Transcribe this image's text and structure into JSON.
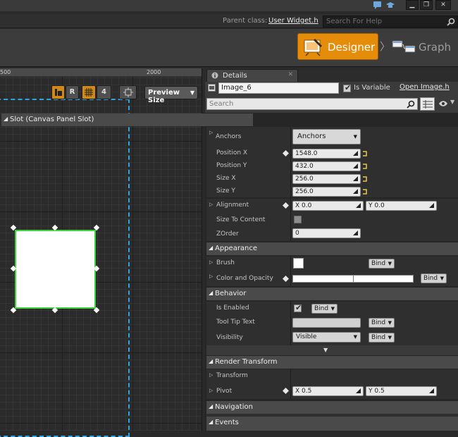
{
  "titlebar": {
    "minimize": "▁",
    "maximize": "❐",
    "close": "✕"
  },
  "parent": {
    "label": "Parent class:",
    "value": "User Widget.h",
    "help_placeholder": "Search For Help"
  },
  "modes": {
    "designer": "Designer",
    "graph": "Graph",
    "separator": "〉"
  },
  "canvas": {
    "ruler": [
      "500",
      "2000"
    ],
    "toolbar": {
      "r_label": "R",
      "grid_size": "4",
      "preview_size": "Preview Size"
    }
  },
  "details": {
    "tab_label": "Details",
    "tab_close": "✕",
    "widget_name": "Image_6",
    "is_variable_label": "Is Variable",
    "is_variable": true,
    "open_link": "Open Image.h",
    "search_placeholder": "Search",
    "sections": {
      "slot": "Slot (Canvas Panel Slot)",
      "appearance": "Appearance",
      "behavior": "Behavior",
      "render_transform": "Render Transform",
      "navigation": "Navigation",
      "events": "Events"
    },
    "slot": {
      "anchors_label": "Anchors",
      "anchors_value": "Anchors",
      "position_x_label": "Position X",
      "position_x": "1548.0",
      "position_y_label": "Position Y",
      "position_y": "432.0",
      "size_x_label": "Size X",
      "size_x": "256.0",
      "size_y_label": "Size Y",
      "size_y": "256.0",
      "alignment_label": "Alignment",
      "alignment_x": "X  0.0",
      "alignment_y": "Y  0.0",
      "size_to_content_label": "Size To Content",
      "zorder_label": "ZOrder",
      "zorder": "0"
    },
    "appearance": {
      "brush_label": "Brush",
      "color_label": "Color and Opacity",
      "bind": "Bind"
    },
    "behavior": {
      "is_enabled_label": "Is Enabled",
      "tooltip_label": "Tool Tip Text",
      "visibility_label": "Visibility",
      "visibility_value": "Visible",
      "bind": "Bind"
    },
    "render_transform": {
      "transform_label": "Transform",
      "pivot_label": "Pivot",
      "pivot_x": "X  0.5",
      "pivot_y": "Y  0.5"
    }
  },
  "colors": {
    "accent": "#e58c0a",
    "selection": "#3fd43f",
    "panel_outline": "#2aa6e6"
  }
}
